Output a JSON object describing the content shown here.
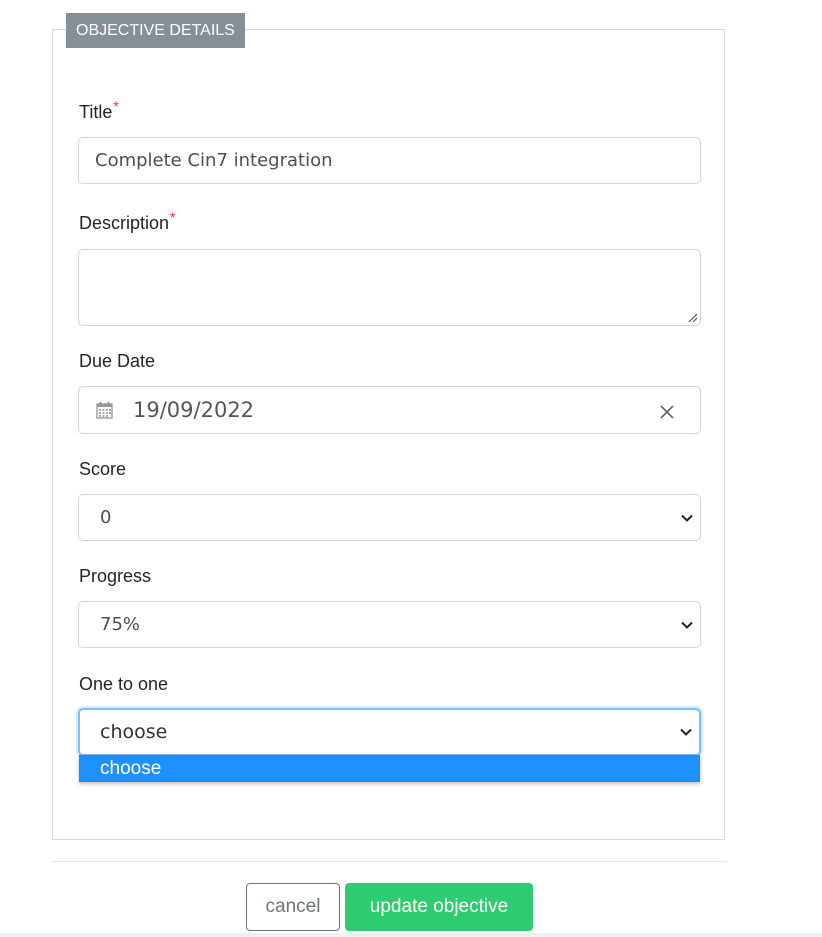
{
  "section": {
    "title": "OBJECTIVE DETAILS"
  },
  "fields": {
    "title": {
      "label": "Title",
      "required_mark": "*",
      "value": "Complete Cin7 integration"
    },
    "description": {
      "label": "Description",
      "required_mark": "*",
      "value": ""
    },
    "due_date": {
      "label": "Due Date",
      "value": "19/09/2022",
      "icon": "calendar-icon",
      "clear_icon": "close-icon"
    },
    "score": {
      "label": "Score",
      "selected": "0"
    },
    "progress": {
      "label": "Progress",
      "selected": "75%"
    },
    "one_to_one": {
      "label": "One to one",
      "selected": "choose",
      "open": true,
      "options": [
        "choose"
      ]
    }
  },
  "actions": {
    "cancel_label": "cancel",
    "update_label": "update objective"
  },
  "colors": {
    "legend_bg": "#868e96",
    "required": "#e03131",
    "primary_button": "#2ecc71",
    "dropdown_highlight": "#1e90ff",
    "focus_border": "#80bdff"
  }
}
